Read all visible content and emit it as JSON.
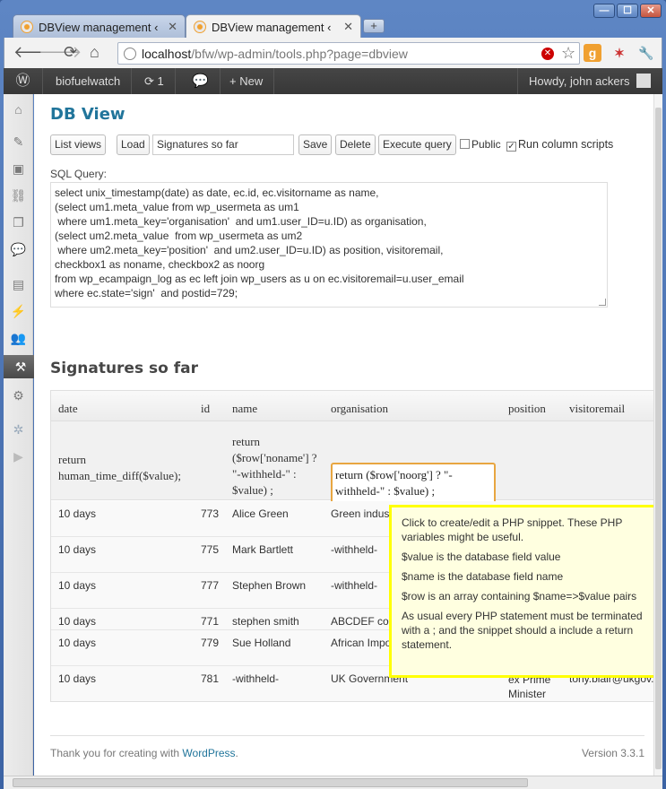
{
  "browser": {
    "tabs": [
      {
        "label": "DBView management ‹ Sa",
        "active": false
      },
      {
        "label": "DBView management ‹ bio",
        "active": true
      }
    ],
    "new_tab": "+",
    "window_controls": [
      "—",
      "☐",
      "✕"
    ],
    "url_host": "localhost",
    "url_path": "/bfw/wp-admin/tools.php?page=dbview"
  },
  "adminbar": {
    "site_name": "biofuelwatch",
    "updates_count": "1",
    "new_label": "New",
    "howdy": "Howdy, john ackers"
  },
  "page": {
    "title": "DB View",
    "buttons": {
      "list_views": "List views",
      "load": "Load",
      "save": "Save",
      "delete": "Delete",
      "execute": "Execute query"
    },
    "query_name": "Signatures so far",
    "public_label": "Public",
    "public_checked": false,
    "run_scripts_label": "Run column scripts",
    "run_scripts_checked": true,
    "sql_label": "SQL Query:",
    "sql": "select unix_timestamp(date) as date, ec.id, ec.visitorname as name,\n(select um1.meta_value from wp_usermeta as um1\n where um1.meta_key='organisation'  and um1.user_ID=u.ID) as organisation,\n(select um2.meta_value  from wp_usermeta as um2\n where um2.meta_key='position'  and um2.user_ID=u.ID) as position, visitoremail,\ncheckbox1 as noname, checkbox2 as noorg\nfrom wp_ecampaign_log as ec left join wp_users as u on ec.visitoremail=u.user_email\nwhere ec.state='sign'  and postid=729;",
    "results_title": "Signatures so far"
  },
  "table": {
    "columns": [
      "date",
      "id",
      "name",
      "organisation",
      "position",
      "visitoremail"
    ],
    "scripts": {
      "date": "return human_time_diff($value);",
      "name": "return ($row['noname'] ? \"-withheld-\" : $value) ;",
      "organisation": "return ($row['noorg'] ? \"-withheld-\" : $value) ;"
    },
    "rows": [
      {
        "date": "10 days",
        "id": "773",
        "name": "Alice Green",
        "organisation": "Green indus",
        "position": "",
        "email": ""
      },
      {
        "date": "10 days",
        "id": "775",
        "name": "Mark Bartlett",
        "organisation": "-withheld-",
        "position": "",
        "email": ""
      },
      {
        "date": "10 days",
        "id": "777",
        "name": "Stephen Brown",
        "organisation": "-withheld-",
        "position": "",
        "email": ""
      },
      {
        "date": "10 days",
        "id": "771",
        "name": "stephen smith",
        "organisation": "ABCDEF co",
        "position": "",
        "email": ""
      },
      {
        "date": "10 days",
        "id": "779",
        "name": "Sue Holland",
        "organisation": "African Impo",
        "position": "",
        "email": ""
      },
      {
        "date": "10 days",
        "id": "781",
        "name": "-withheld-",
        "organisation": "UK Government",
        "position": "ex Prime Minister",
        "email": "tony.blair@ukgov.com"
      }
    ]
  },
  "tooltip": {
    "intro": "Click to create/edit a PHP snippet. These PHP variables might be useful.",
    "value_line": "$value is the database field value",
    "name_line": "$name is the database field name",
    "row_line": "$row is an array containing $name=>$value pairs",
    "note": "As usual every PHP statement must be terminated with a ; and the snippet should a include a return statement."
  },
  "footer": {
    "thanks": "Thank you for creating with ",
    "wp_link": "WordPress",
    "period": ".",
    "version": "Version 3.3.1"
  }
}
